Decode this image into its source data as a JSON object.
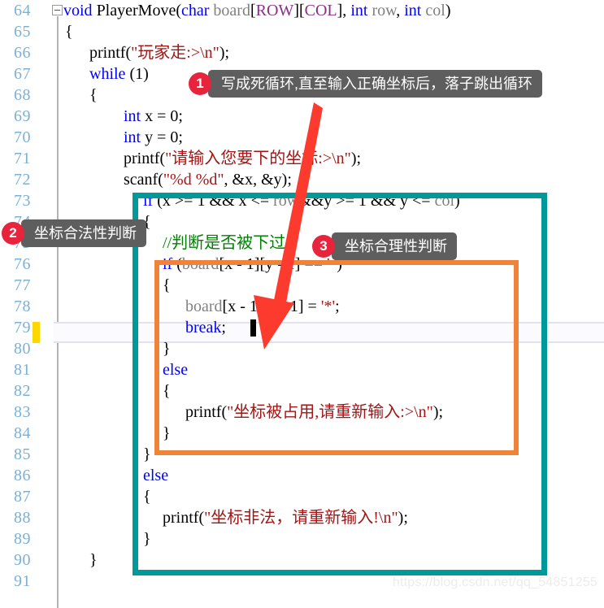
{
  "editor": {
    "language": "c",
    "first_line_number": 64,
    "current_line_number": 79,
    "colors": {
      "keyword": "#0000ff",
      "string": "#a31515",
      "comment": "#008000",
      "macro": "#8b2f8b",
      "dim_identifier": "#808080",
      "line_number": "#7ab0d6",
      "edit_marker": "#ffd700",
      "teal_box": "#009999",
      "orange_box": "#f0833a",
      "arrow": "#fc3b2e",
      "badge": "#e8243c",
      "bubble": "#5e5e5e"
    },
    "line_numbers": [
      64,
      65,
      66,
      67,
      68,
      69,
      70,
      71,
      72,
      73,
      74,
      75,
      76,
      77,
      78,
      79,
      80,
      81,
      82,
      83,
      84,
      85,
      86,
      87,
      88,
      89,
      90,
      91
    ],
    "lines": [
      {
        "n": 64,
        "indent": 0,
        "text": "void PlayerMove(char board[ROW][COL], int row, int col)"
      },
      {
        "n": 65,
        "indent": 1,
        "text": "{"
      },
      {
        "n": 66,
        "indent": 2,
        "text": "printf(\"玩家走:>\\n\");"
      },
      {
        "n": 67,
        "indent": 2,
        "text": "while (1)"
      },
      {
        "n": 68,
        "indent": 2,
        "text": "{"
      },
      {
        "n": 69,
        "indent": 3,
        "text": "int x = 0;"
      },
      {
        "n": 70,
        "indent": 3,
        "text": "int y = 0;"
      },
      {
        "n": 71,
        "indent": 3,
        "text": "printf(\"请输入您要下的坐标:>\\n\");"
      },
      {
        "n": 72,
        "indent": 3,
        "text": "scanf(\"%d %d\", &x, &y);"
      },
      {
        "n": 73,
        "indent": 3,
        "text": "if (x >= 1 && x <= row&&y >= 1 && y <= col)"
      },
      {
        "n": 74,
        "indent": 3,
        "text": "{"
      },
      {
        "n": 75,
        "indent": 4,
        "text": "//判断是否被下过"
      },
      {
        "n": 76,
        "indent": 4,
        "text": "if (board[x - 1][y - 1] == ' ')"
      },
      {
        "n": 77,
        "indent": 4,
        "text": "{"
      },
      {
        "n": 78,
        "indent": 5,
        "text": "board[x - 1][y - 1] = '*';"
      },
      {
        "n": 79,
        "indent": 5,
        "text": "break;"
      },
      {
        "n": 80,
        "indent": 4,
        "text": "}"
      },
      {
        "n": 81,
        "indent": 4,
        "text": "else"
      },
      {
        "n": 82,
        "indent": 4,
        "text": "{"
      },
      {
        "n": 83,
        "indent": 5,
        "text": "printf(\"坐标被占用,请重新输入:>\\n\");"
      },
      {
        "n": 84,
        "indent": 4,
        "text": "}"
      },
      {
        "n": 85,
        "indent": 3,
        "text": "}"
      },
      {
        "n": 86,
        "indent": 3,
        "text": "else"
      },
      {
        "n": 87,
        "indent": 3,
        "text": "{"
      },
      {
        "n": 88,
        "indent": 4,
        "text": "printf(\"坐标非法，请重新输入!\\n\");"
      },
      {
        "n": 89,
        "indent": 3,
        "text": "}"
      },
      {
        "n": 90,
        "indent": 2,
        "text": "}"
      },
      {
        "n": 91,
        "indent": 0,
        "text": ""
      }
    ]
  },
  "annotations": {
    "callouts": [
      {
        "id": "1",
        "badge": "1",
        "text": "写成死循环,直至输入正确坐标后，落子跳出循环"
      },
      {
        "id": "2",
        "badge": "2",
        "text": "坐标合法性判断"
      },
      {
        "id": "3",
        "badge": "3",
        "text": "坐标合理性判断"
      }
    ],
    "boxes": [
      {
        "id": "teal",
        "label": "outer-validity-block",
        "color": "#009999"
      },
      {
        "id": "orange",
        "label": "inner-occupancy-block",
        "color": "#f0833a"
      }
    ],
    "arrow": {
      "label": "red-arrow-pointing-to-break"
    }
  },
  "watermark": {
    "text": "https://blog.csdn.net/qq_54851255"
  }
}
